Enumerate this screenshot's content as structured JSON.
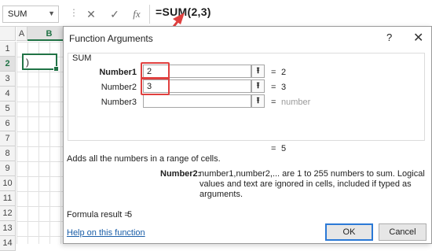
{
  "formula_bar": {
    "name_box": "SUM",
    "name_box_dropdown_icon": "chevron-down-icon",
    "separator": "⋮",
    "cancel_icon": "close-icon",
    "enter_icon": "check-icon",
    "insert_function_label": "fx",
    "formula": "=SUM(2,3)"
  },
  "grid": {
    "columns": [
      "A",
      "B"
    ],
    "rows": [
      "1",
      "2",
      "3",
      "4",
      "5",
      "6",
      "7",
      "8",
      "9",
      "10",
      "11",
      "12",
      "13",
      "14"
    ],
    "active_cell_content": ")"
  },
  "dialog": {
    "title": "Function Arguments",
    "help_label": "?",
    "close_label": "✕",
    "function_name": "SUM",
    "arguments": [
      {
        "label": "Number1",
        "value": "2",
        "result": "2"
      },
      {
        "label": "Number2",
        "value": "3",
        "result": "3"
      },
      {
        "label": "Number3",
        "value": "",
        "result": "number"
      }
    ],
    "collapse_icon": "⭱",
    "equals": "=",
    "overall_equals": "=",
    "overall_result": "5",
    "description": "Adds all the numbers in a range of cells.",
    "arg_help_name": "Number2:",
    "arg_help_text": "number1,number2,... are 1 to 255 numbers to sum. Logical values and text are ignored in cells, included if typed as arguments.",
    "formula_result_label": "Formula result =",
    "formula_result_value": "5",
    "help_link": "Help on this function",
    "ok_label": "OK",
    "cancel_label": "Cancel"
  },
  "annotation": {
    "highlight_color": "#e0403f"
  }
}
